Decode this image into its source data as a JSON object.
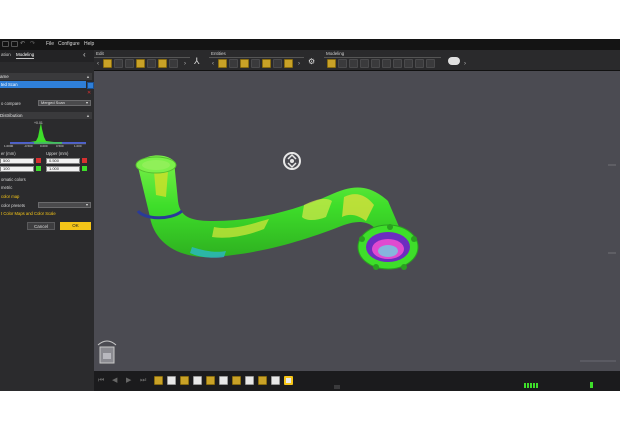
{
  "menu": {
    "file": "File",
    "configure": "Configure",
    "help": "Help"
  },
  "toolbar": {
    "groups": [
      {
        "title": "Edit"
      },
      {
        "title": "Entities"
      },
      {
        "title": "Modeling"
      }
    ]
  },
  "panel": {
    "tabs": {
      "left": "ation",
      "active": "Modeling"
    },
    "section1": {
      "title": "ame"
    },
    "selected_item": "ted Scan",
    "compare_label": "o compare",
    "compare_value": "Merged Scan",
    "section2": {
      "title": "Distribution"
    },
    "hist": {
      "tick1": "1.0000",
      "tick2": "-0.500",
      "tick3": "0.000",
      "tick4": "0.500",
      "tick5": "1.000",
      "peak": "+0.01"
    },
    "lower_label": "er (mm)",
    "upper_label": "Upper (mm)",
    "lower_row1": "500",
    "upper_row1": "0.500",
    "lower_row2": "100",
    "upper_row2": "1.000",
    "auto_colors": "omatic colors",
    "symmetric": "metric",
    "clip_link": "color map",
    "presets": "color presets",
    "cmap_link": "t Color Maps and Color Scale",
    "cancel": "Cancel",
    "ok": "OK"
  },
  "colors": {
    "accent_yellow": "#f5c518",
    "selection_blue": "#2f7fd8",
    "viewport_bg": "#4b4b52",
    "pipe_green": "#3ede2a"
  },
  "icons": [
    "undo-icon",
    "redo-icon",
    "move-icon",
    "rotate-icon",
    "pipe-icon",
    "cut-icon",
    "merge-icon",
    "cube-icon",
    "clock-icon",
    "hide-icon"
  ]
}
